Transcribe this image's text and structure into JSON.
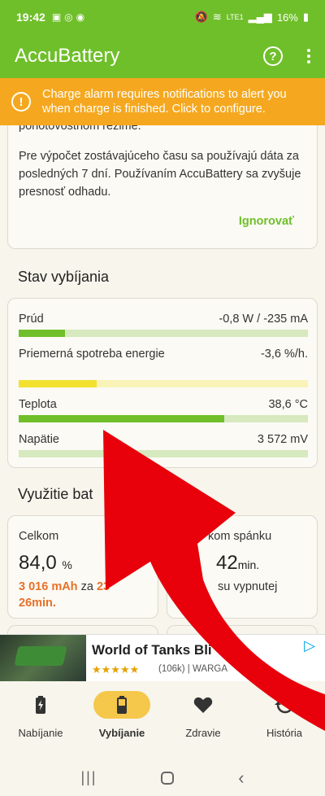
{
  "status_bar": {
    "time": "19:42",
    "battery": "16%",
    "network": "LTE1"
  },
  "app": {
    "title": "AccuBattery"
  },
  "alert": {
    "text": "Charge alarm requires notifications to alert you when charge is finished. Click to configure."
  },
  "info_card": {
    "text1": "pohotovostnom režime.",
    "text2": "Pre výpočet zostávajúceho času sa používajú dáta za posledných 7 dní. Používaním AccuBattery sa zvyšuje presnosť odhadu.",
    "ignore_label": "Ignorovať"
  },
  "discharge": {
    "title": "Stav vybíjania",
    "rows": [
      {
        "label": "Prúd",
        "value": "-0,8 W / -235 mA",
        "level": 0.16
      },
      {
        "label": "Priemerná spotreba energie",
        "value": "-3,6 %/h.",
        "level": 0.27
      },
      {
        "label": "Teplota",
        "value": "38,6 °C",
        "level": 0.71
      },
      {
        "label": "Napätie",
        "value": "3 572 mV",
        "level": 0.0
      }
    ]
  },
  "usage": {
    "title": "Využitie bat",
    "total": {
      "label": "Celkom",
      "value": "84,0",
      "unit": "%",
      "mah": "3 016 mAh",
      "za": "za",
      "time_a": "23",
      "time_b": "26min."
    },
    "sleep": {
      "label": "kom spánku",
      "value": "42",
      "unit": "min.",
      "desc": "su vypnutej"
    }
  },
  "ad": {
    "title": "World of Tanks Bli",
    "stars": "★★★★★",
    "reviews": "(106k)",
    "publisher": "WARGA"
  },
  "nav": {
    "items": [
      {
        "label": "Nabíjanie",
        "icon": "charging-battery-icon"
      },
      {
        "label": "Vybíjanie",
        "icon": "battery-icon"
      },
      {
        "label": "Zdravie",
        "icon": "heart-icon"
      },
      {
        "label": "História",
        "icon": "history-icon"
      }
    ]
  },
  "colors": {
    "primary": "#6fbf2a",
    "alert": "#f5a81f",
    "accent_yellow": "#f5c74a",
    "orange_text": "#e8702a",
    "arrow": "#e8000b"
  }
}
